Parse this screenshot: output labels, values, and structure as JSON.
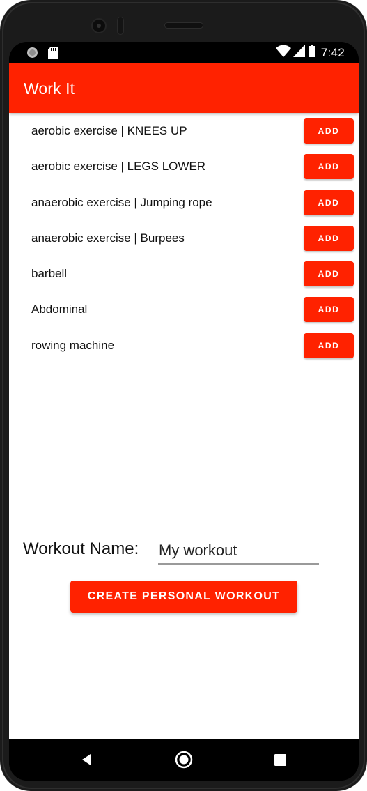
{
  "status_bar": {
    "time": "7:42",
    "icons": [
      "circle-status-icon",
      "sd-card-icon",
      "wifi-icon",
      "signal-icon",
      "battery-icon"
    ]
  },
  "app_bar": {
    "title": "Work It",
    "color": "#ff2200"
  },
  "exercises": [
    {
      "label": "aerobic exercise | KNEES UP",
      "button": "ADD"
    },
    {
      "label": "aerobic exercise | LEGS LOWER",
      "button": "ADD"
    },
    {
      "label": "anaerobic exercise | Jumping rope",
      "button": "ADD"
    },
    {
      "label": "anaerobic exercise | Burpees",
      "button": "ADD"
    },
    {
      "label": "barbell",
      "button": "ADD"
    },
    {
      "label": "Abdominal",
      "button": "ADD"
    },
    {
      "label": "rowing machine",
      "button": "ADD"
    }
  ],
  "workout_form": {
    "name_label": "Workout Name:",
    "name_value": "My workout",
    "create_button": "CREATE PERSONAL WORKOUT"
  },
  "nav_bar": {
    "icons": [
      "back-icon",
      "home-icon",
      "recents-icon"
    ]
  }
}
